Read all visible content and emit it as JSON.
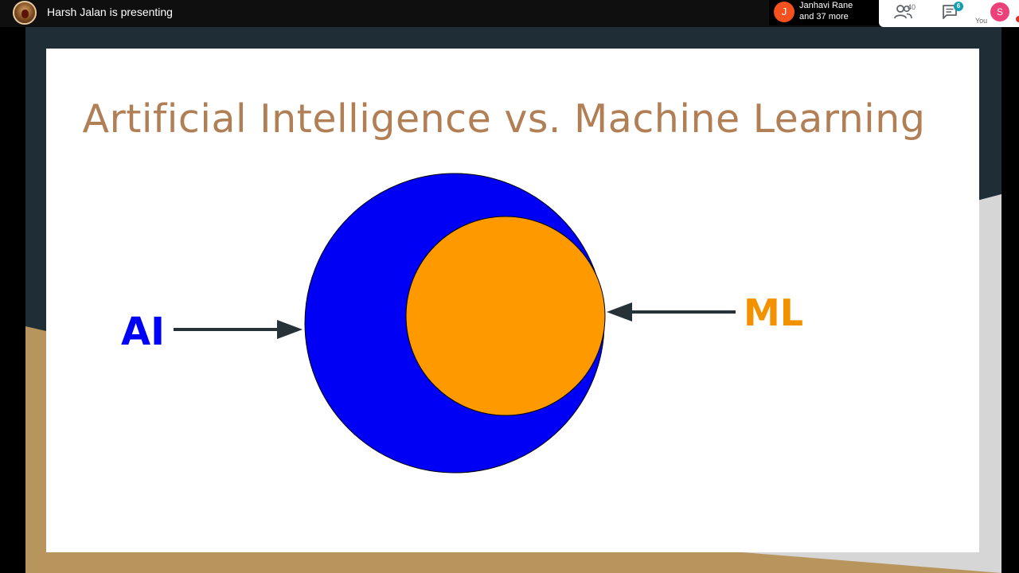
{
  "meeting": {
    "presenter_text": "Harsh Jalan is presenting",
    "participant_chip": {
      "initial": "J",
      "name": "Janhavi Rane",
      "others": "and 37 more"
    },
    "people_count": "40",
    "chat_badge": "6",
    "self": {
      "initial": "S",
      "label": "You"
    }
  },
  "slide": {
    "title": "Artificial Intelligence vs. Machine Learning",
    "outer_label": "AI",
    "inner_label": "ML",
    "colors": {
      "outer": "#0000f5",
      "inner": "#ff9900",
      "title": "#b17f55",
      "arrow": "#263238"
    }
  },
  "icons": [
    "people-icon",
    "chat-icon"
  ]
}
